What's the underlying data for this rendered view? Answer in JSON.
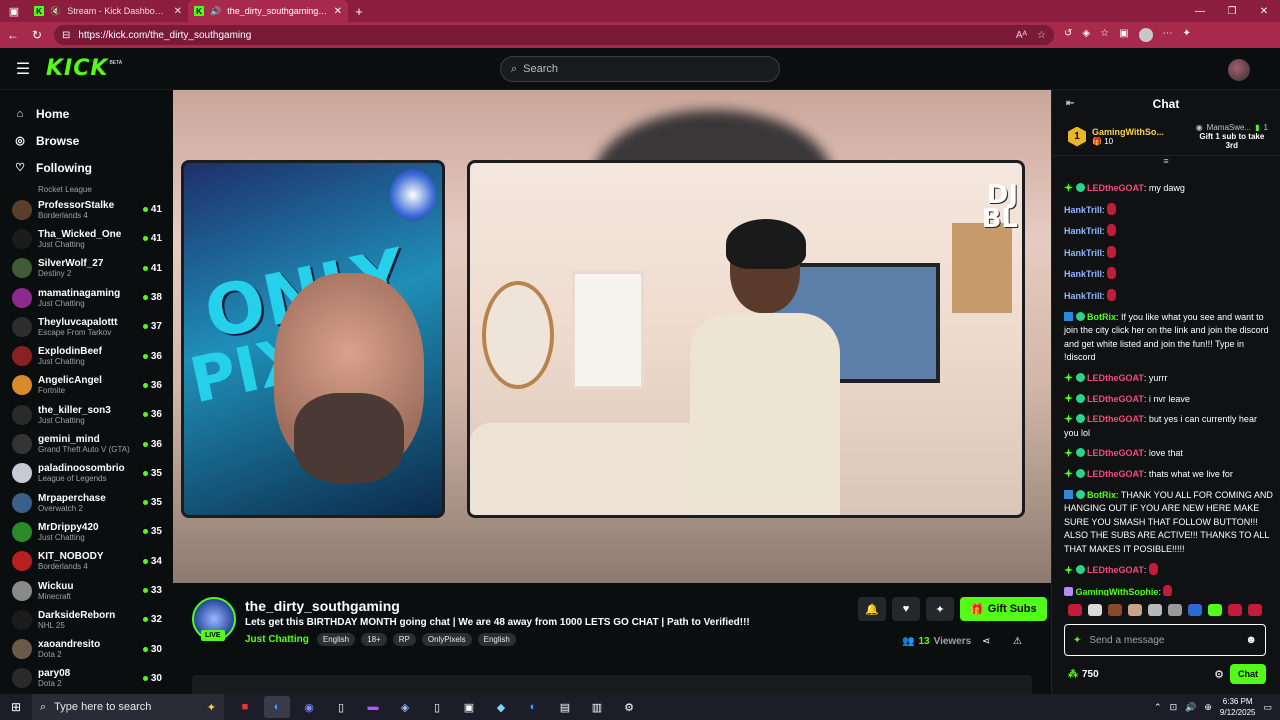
{
  "browser": {
    "tabs": [
      {
        "title": "Stream - Kick Dashboard",
        "active": false
      },
      {
        "title": "the_dirty_southgaming Strea",
        "active": true
      }
    ],
    "url": "https://kick.com/the_dirty_southgaming"
  },
  "header": {
    "logo": "KICK",
    "beta": "BETA",
    "search_placeholder": "Search"
  },
  "sidebar": {
    "nav": [
      {
        "label": "Home",
        "icon": "home-icon"
      },
      {
        "label": "Browse",
        "icon": "compass-icon"
      },
      {
        "label": "Following",
        "icon": "heart-icon"
      }
    ],
    "partial_category": "Rocket League",
    "channels": [
      {
        "name": "ProfessorStalke",
        "category": "Borderlands 4",
        "viewers": "41",
        "color": "#5a3d2b"
      },
      {
        "name": "Tha_Wicked_One",
        "category": "Just Chatting",
        "viewers": "41",
        "color": "#1c1c1c"
      },
      {
        "name": "SilverWolf_27",
        "category": "Destiny 2",
        "viewers": "41",
        "color": "#3f5c36"
      },
      {
        "name": "mamatinagaming",
        "category": "Just Chatting",
        "viewers": "38",
        "color": "#8a2a8f"
      },
      {
        "name": "Theyluvcapalottt",
        "category": "Escape From Tarkov",
        "viewers": "37",
        "color": "#2d2d2d"
      },
      {
        "name": "ExplodinBeef",
        "category": "Just Chatting",
        "viewers": "36",
        "color": "#8a2020"
      },
      {
        "name": "AngelicAngel",
        "category": "Fortnite",
        "viewers": "36",
        "color": "#d98a2b"
      },
      {
        "name": "the_killer_son3",
        "category": "Just Chatting",
        "viewers": "36",
        "color": "#2a2a2a"
      },
      {
        "name": "gemini_mind",
        "category": "Grand Theft Auto V (GTA)",
        "viewers": "36",
        "color": "#333333"
      },
      {
        "name": "paladinoosombrio",
        "category": "League of Legends",
        "viewers": "35",
        "color": "#c9c9d6"
      },
      {
        "name": "Mrpaperchase",
        "category": "Overwatch 2",
        "viewers": "35",
        "color": "#3a5f8a"
      },
      {
        "name": "MrDrippy420",
        "category": "Just Chatting",
        "viewers": "35",
        "color": "#2a8a2a"
      },
      {
        "name": "KIT_NOBODY",
        "category": "Borderlands 4",
        "viewers": "34",
        "color": "#b82020"
      },
      {
        "name": "Wickuu",
        "category": "Minecraft",
        "viewers": "33",
        "color": "#8a8a8a"
      },
      {
        "name": "DarksideReborn",
        "category": "NHL 25",
        "viewers": "32",
        "color": "#1c1c1c"
      },
      {
        "name": "xaoandresito",
        "category": "Dota 2",
        "viewers": "30",
        "color": "#6a5a4a"
      },
      {
        "name": "pary08",
        "category": "Dota 2",
        "viewers": "30",
        "color": "#2a2a2a"
      }
    ]
  },
  "player": {
    "overlay_text": [
      "ONLY",
      "PIX"
    ],
    "cam2_tag": [
      "DJ",
      "BL"
    ]
  },
  "stream": {
    "live": "LIVE",
    "name": "the_dirty_southgaming",
    "title": "Lets get this BIRTHDAY MONTH going chat | We are 48 away from 1000 LETS GO CHAT | Path to Verified!!!",
    "category": "Just Chatting",
    "tags": [
      "English",
      "18+",
      "RP",
      "OnlyPixels",
      "English"
    ],
    "gift_label": "Gift Subs",
    "viewers_count": "13",
    "viewers_label": "Viewers"
  },
  "chat": {
    "title": "Chat",
    "leaderboard": {
      "rank": "1",
      "user": "GamingWithSo...",
      "score": "10",
      "right_user": "MamaSwe...",
      "right_count": "1",
      "gift_prompt_line1": "Gift 1 sub to take",
      "gift_prompt_line2": "3rd"
    },
    "messages": [
      {
        "user": "LEDtheGOAT",
        "color": "#f34b7b",
        "badges": [
          "g",
          "v"
        ],
        "text": "my dawg",
        "emote": false
      },
      {
        "user": "HankTrill",
        "color": "#8fb6ff",
        "badges": [],
        "text": "",
        "emote": true
      },
      {
        "user": "HankTrill",
        "color": "#8fb6ff",
        "badges": [],
        "text": "",
        "emote": true
      },
      {
        "user": "HankTrill",
        "color": "#8fb6ff",
        "badges": [],
        "text": "",
        "emote": true
      },
      {
        "user": "HankTrill",
        "color": "#8fb6ff",
        "badges": [],
        "text": "",
        "emote": true
      },
      {
        "user": "HankTrill",
        "color": "#8fb6ff",
        "badges": [],
        "text": "",
        "emote": true
      },
      {
        "user": "BotRix",
        "color": "#53fc18",
        "badges": [
          "b",
          "v"
        ],
        "text": "If you like what you see and want to join the city click her on the link and join the discord and get white listed and join the fun!!! Type in !discord",
        "emote": false
      },
      {
        "user": "LEDtheGOAT",
        "color": "#f34b7b",
        "badges": [
          "g",
          "v"
        ],
        "text": "yurrr",
        "emote": false
      },
      {
        "user": "LEDtheGOAT",
        "color": "#f34b7b",
        "badges": [
          "g",
          "v"
        ],
        "text": "i nvr leave",
        "emote": false
      },
      {
        "user": "LEDtheGOAT",
        "color": "#f34b7b",
        "badges": [
          "g",
          "v"
        ],
        "text": "but yes i can currently hear you lol",
        "emote": false
      },
      {
        "user": "LEDtheGOAT",
        "color": "#f34b7b",
        "badges": [
          "g",
          "v"
        ],
        "text": "love that",
        "emote": false
      },
      {
        "user": "LEDtheGOAT",
        "color": "#f34b7b",
        "badges": [
          "g",
          "v"
        ],
        "text": "thats what we live for",
        "emote": false
      },
      {
        "user": "BotRix",
        "color": "#53fc18",
        "badges": [
          "b",
          "v"
        ],
        "text": "THANK YOU ALL FOR COMING AND HANGING OUT IF YOU ARE NEW HERE MAKE SURE YOU SMASH THAT FOLLOW BUTTON!!! ALSO THE SUBS ARE ACTIVE!!! THANKS TO ALL THAT MAKES IT POSIBLE!!!!!",
        "emote": false
      },
      {
        "user": "LEDtheGOAT",
        "color": "#f34b7b",
        "badges": [
          "g",
          "v"
        ],
        "text": "",
        "emote": true
      },
      {
        "user": "GamingWithSophie",
        "color": "#53fc18",
        "badges": [
          "s"
        ],
        "text": "",
        "emote": true
      }
    ],
    "input_placeholder": "Send a message",
    "points": "750",
    "send_label": "Chat"
  },
  "taskbar": {
    "search_text": "Type here to search",
    "time": "6:36 PM",
    "date": "9/12/2025"
  }
}
